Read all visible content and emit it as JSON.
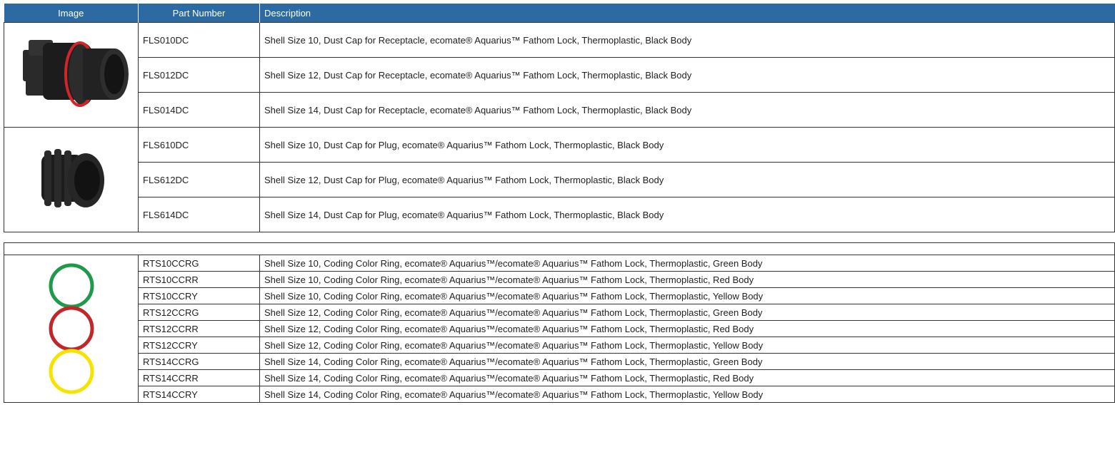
{
  "header": {
    "image": "Image",
    "part_number": "Part Number",
    "description": "Description"
  },
  "images": {
    "receptacle_cap": "receptacle-dust-cap-icon",
    "plug_cap": "plug-dust-cap-icon",
    "coding_rings": "coding-color-rings-icon"
  },
  "colors": {
    "header_bg": "#2b6aa2",
    "ring_green": "#1e9a4a",
    "ring_red": "#c0262a",
    "ring_yellow": "#f4e400",
    "cap_black": "#1c1c1c",
    "cap_seal": "#d0262a"
  },
  "receptacle_caps": [
    {
      "part": "FLS010DC",
      "desc": "Shell Size 10, Dust Cap for Receptacle, ecomate® Aquarius™ Fathom Lock, Thermoplastic, Black Body"
    },
    {
      "part": "FLS012DC",
      "desc": "Shell Size 12, Dust Cap for Receptacle, ecomate® Aquarius™ Fathom Lock, Thermoplastic, Black Body"
    },
    {
      "part": "FLS014DC",
      "desc": "Shell Size 14, Dust Cap for Receptacle, ecomate® Aquarius™ Fathom Lock, Thermoplastic, Black Body"
    }
  ],
  "plug_caps": [
    {
      "part": "FLS610DC",
      "desc": "Shell Size 10, Dust Cap for Plug, ecomate® Aquarius™ Fathom Lock, Thermoplastic, Black Body"
    },
    {
      "part": "FLS612DC",
      "desc": "Shell Size 12, Dust Cap for Plug, ecomate® Aquarius™ Fathom Lock, Thermoplastic, Black Body"
    },
    {
      "part": "FLS614DC",
      "desc": "Shell Size 14, Dust Cap for Plug, ecomate® Aquarius™ Fathom Lock, Thermoplastic, Black Body"
    }
  ],
  "rings": [
    {
      "part": "RTS10CCRG",
      "desc": "Shell Size 10, Coding Color Ring, ecomate® Aquarius™/ecomate® Aquarius™ Fathom Lock, Thermoplastic, Green Body"
    },
    {
      "part": "RTS10CCRR",
      "desc": "Shell Size 10, Coding Color Ring, ecomate® Aquarius™/ecomate® Aquarius™ Fathom Lock, Thermoplastic, Red Body"
    },
    {
      "part": "RTS10CCRY",
      "desc": "Shell Size 10, Coding Color Ring, ecomate® Aquarius™/ecomate® Aquarius™ Fathom Lock, Thermoplastic, Yellow Body"
    },
    {
      "part": "RTS12CCRG",
      "desc": "Shell Size 12, Coding Color Ring, ecomate® Aquarius™/ecomate® Aquarius™ Fathom Lock, Thermoplastic, Green Body"
    },
    {
      "part": "RTS12CCRR",
      "desc": "Shell Size 12, Coding Color Ring, ecomate® Aquarius™/ecomate® Aquarius™ Fathom Lock, Thermoplastic, Red Body"
    },
    {
      "part": "RTS12CCRY",
      "desc": "Shell Size 12, Coding Color Ring, ecomate® Aquarius™/ecomate® Aquarius™ Fathom Lock, Thermoplastic, Yellow Body"
    },
    {
      "part": "RTS14CCRG",
      "desc": "Shell Size 14, Coding Color Ring, ecomate® Aquarius™/ecomate® Aquarius™ Fathom Lock, Thermoplastic, Green Body"
    },
    {
      "part": "RTS14CCRR",
      "desc": "Shell Size 14, Coding Color Ring, ecomate® Aquarius™/ecomate® Aquarius™ Fathom Lock, Thermoplastic, Red Body"
    },
    {
      "part": "RTS14CCRY",
      "desc": "Shell Size 14, Coding Color Ring, ecomate® Aquarius™/ecomate® Aquarius™ Fathom Lock, Thermoplastic, Yellow Body"
    }
  ]
}
